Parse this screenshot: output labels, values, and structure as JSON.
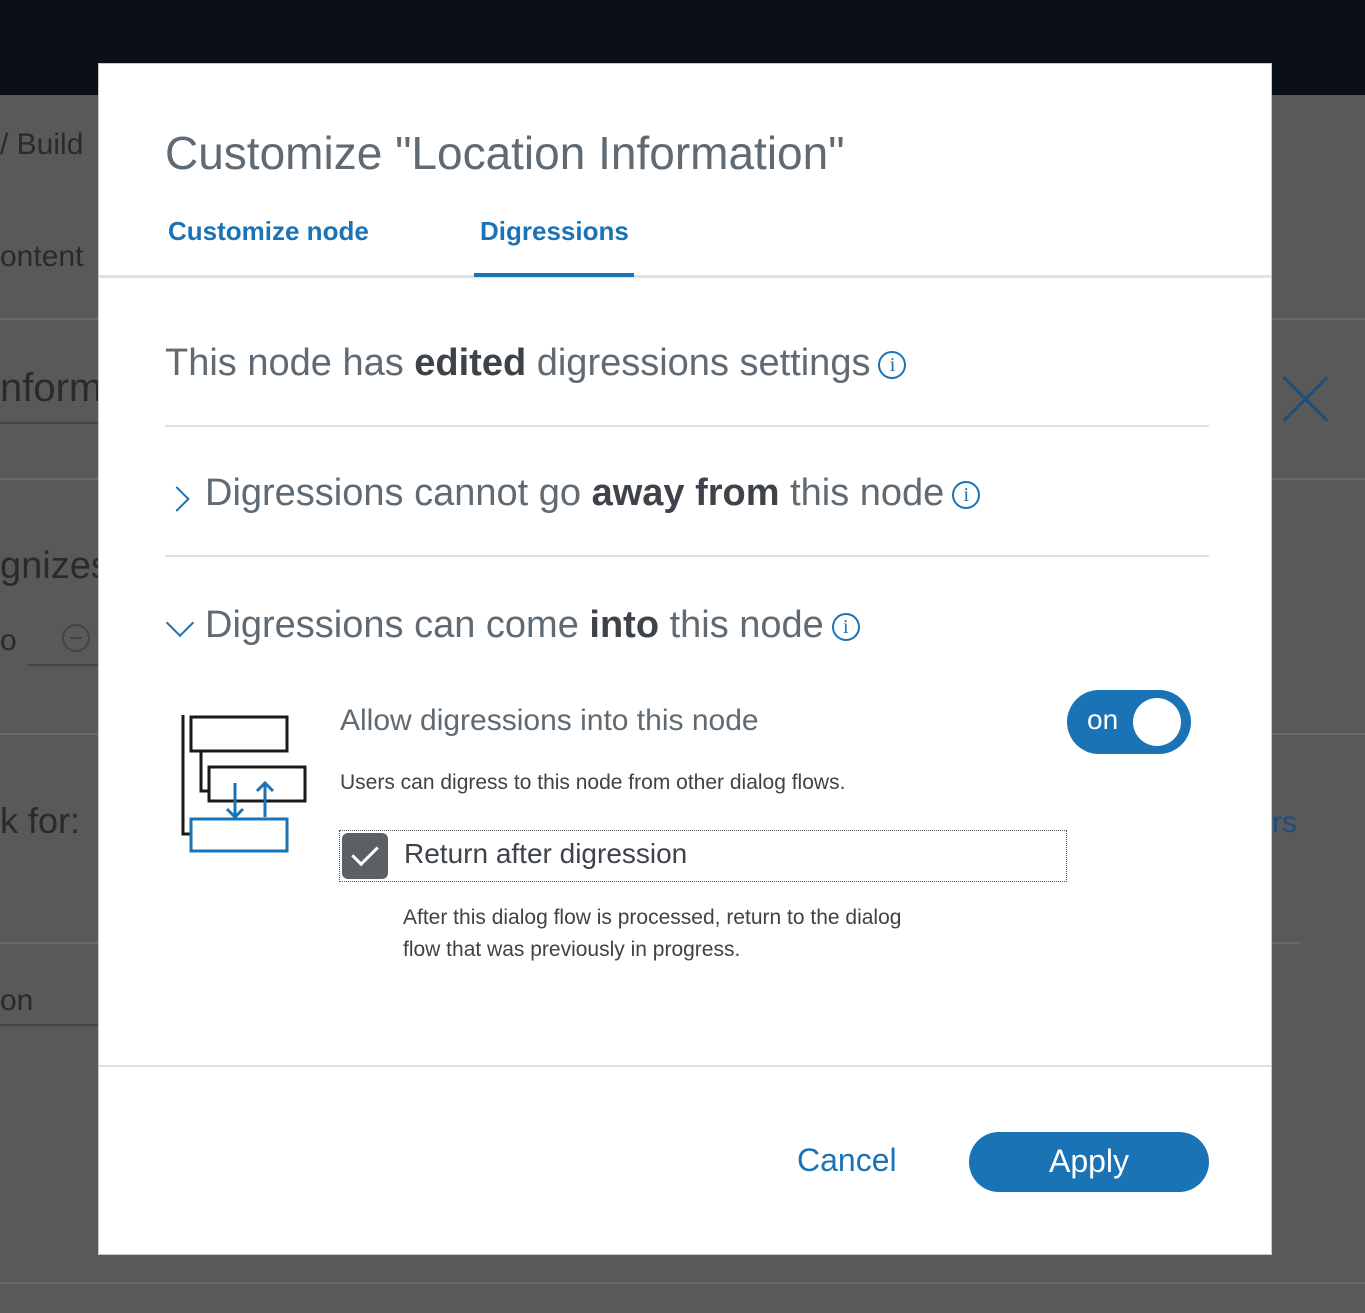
{
  "background": {
    "breadcrumb_fragment": "/ Build",
    "content_fragment": "ontent",
    "node_name_fragment": "nforma",
    "recognizes_fragment": "gnizes",
    "condition_fragment": "o",
    "check_for_fragment": "k for:",
    "right_link_fragment": "rs",
    "response_fragment": "on"
  },
  "modal": {
    "title": "Customize \"Location Information\"",
    "tabs": [
      {
        "label": "Customize node",
        "active": false
      },
      {
        "label": "Digressions",
        "active": true
      }
    ],
    "status_heading": {
      "prefix": "This node has ",
      "bold": "edited",
      "suffix": " digressions settings"
    },
    "section_away": {
      "prefix": "Digressions cannot go ",
      "bold": "away from",
      "suffix": " this node",
      "expanded": false
    },
    "section_into": {
      "prefix": "Digressions can come ",
      "bold": "into",
      "suffix": " this node",
      "expanded": true
    },
    "allow_label": "Allow digressions into this node",
    "allow_description": "Users can digress to this node from other dialog flows.",
    "toggle": {
      "label": "on",
      "state": true
    },
    "return_checkbox": {
      "label": "Return after digression",
      "checked": true
    },
    "return_description": "After this dialog flow is processed, return to the dialog flow that was previously in progress.",
    "cancel_label": "Cancel",
    "apply_label": "Apply",
    "info_glyph": "i"
  },
  "colors": {
    "accent": "#1a73b5",
    "text": "#5f6a73",
    "checkbox": "#5a6064"
  }
}
